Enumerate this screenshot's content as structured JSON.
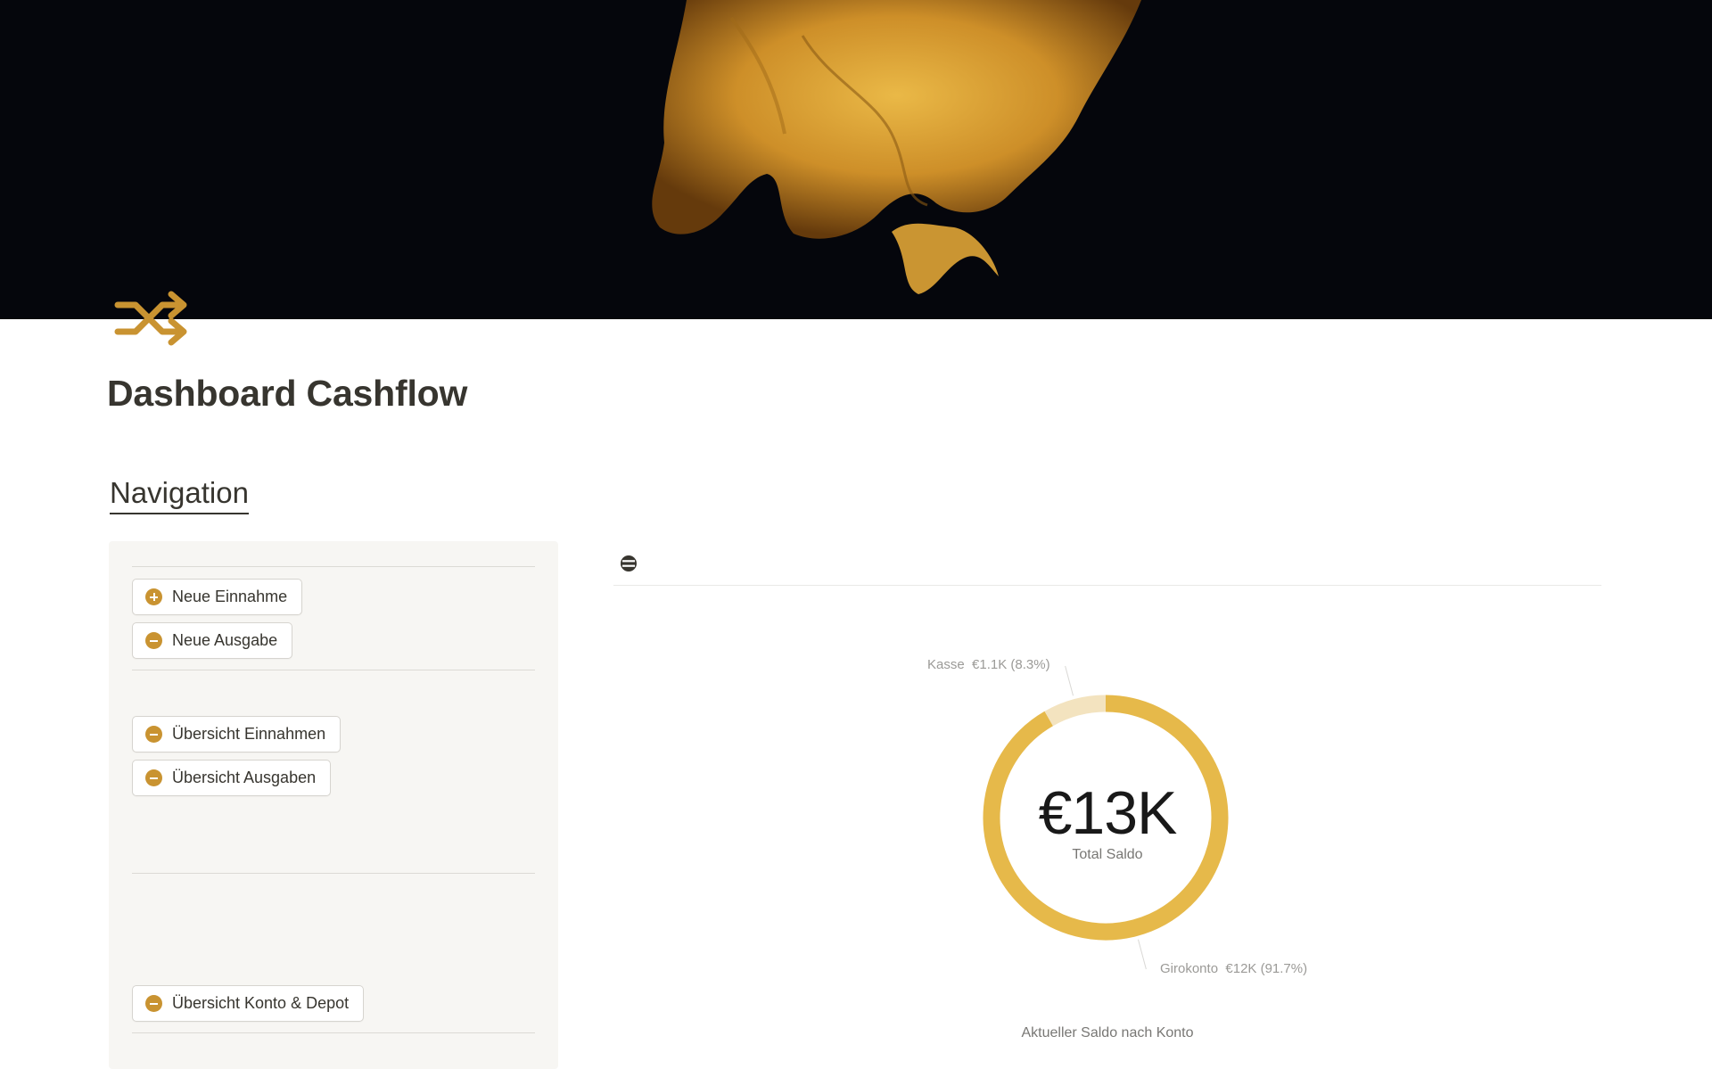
{
  "page": {
    "title": "Dashboard Cashflow",
    "icon": "shuffle-icon",
    "cover": "flame-cover-image"
  },
  "navigation": {
    "heading": "Navigation",
    "buttons": [
      {
        "label": "Neue Einnahme",
        "icon": "plus-circle-icon"
      },
      {
        "label": "Neue Ausgabe",
        "icon": "minus-circle-icon"
      },
      {
        "label": "Übersicht Einnahmen",
        "icon": "minus-circle-icon"
      },
      {
        "label": "Übersicht Ausgaben",
        "icon": "minus-circle-icon"
      },
      {
        "label": "Übersicht Konto & Depot",
        "icon": "minus-circle-icon"
      }
    ]
  },
  "chart_data": {
    "type": "pie",
    "variant": "donut",
    "center_value": "€13K",
    "center_label": "Total Saldo",
    "caption": "Aktueller Saldo nach Konto",
    "slices": [
      {
        "name": "Kasse",
        "value_label": "€1.1K (8.3%)",
        "percent": 8.3,
        "color": "#f3e3bf"
      },
      {
        "name": "Girokonto",
        "value_label": "€12K (91.7%)",
        "percent": 91.7,
        "color": "#e6b94a"
      }
    ]
  },
  "colors": {
    "accent": "#c99331",
    "panel_bg": "#f7f6f3",
    "text": "#37352f"
  }
}
